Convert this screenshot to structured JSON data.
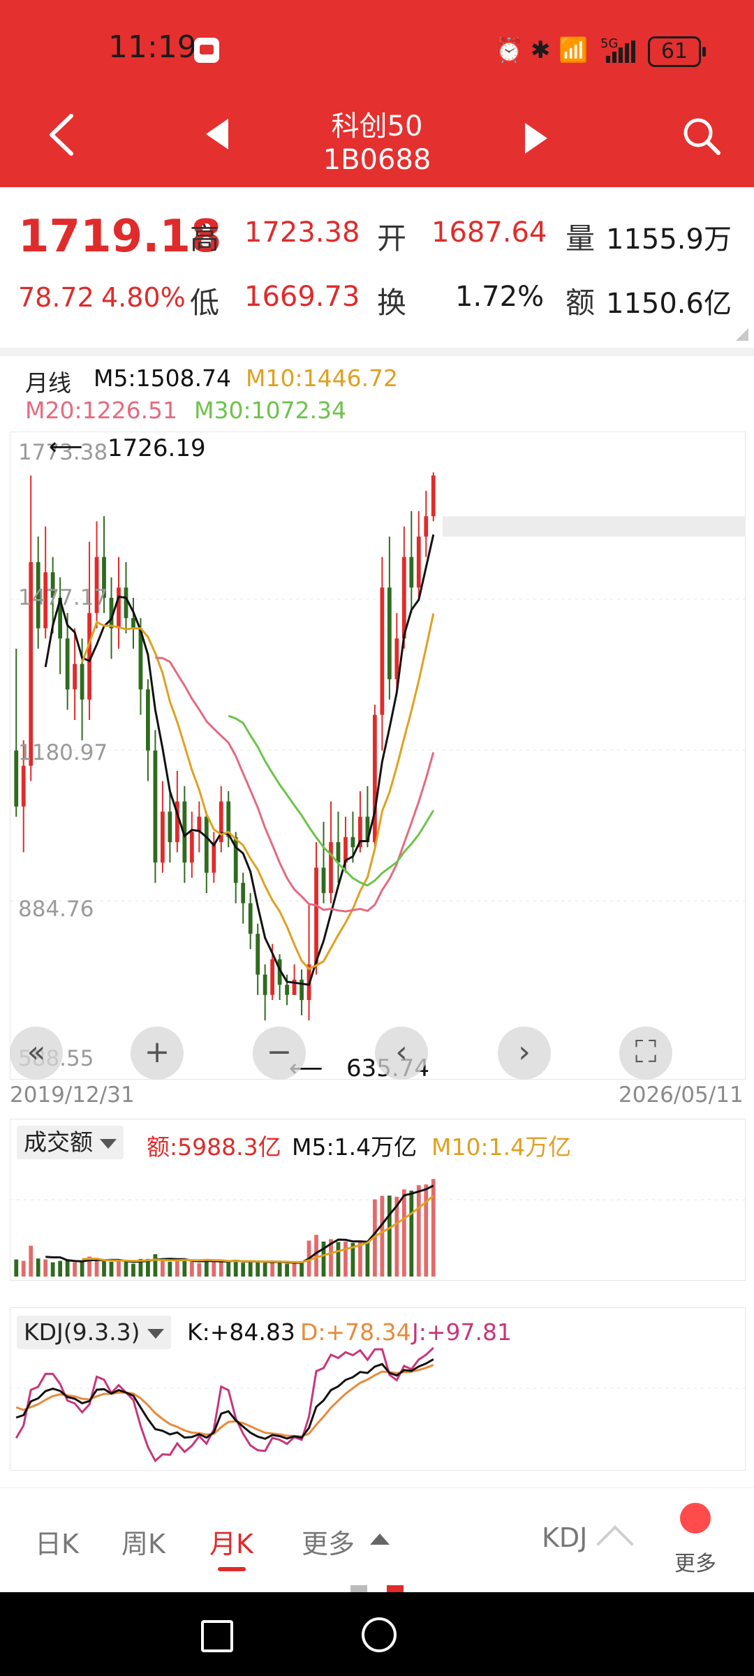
{
  "status_bar": {
    "time": "11:19",
    "battery": "61",
    "signal": "5G"
  },
  "header": {
    "name": "科创50",
    "code": "1B0688"
  },
  "quote": {
    "last": "1719.18",
    "change": "78.72",
    "change_pct": "4.80%",
    "high_label": "高",
    "high": "1723.38",
    "low_label": "低",
    "low": "1669.73",
    "open_label": "开",
    "open": "1687.64",
    "turnover_label": "换",
    "turnover": "1.72%",
    "volume_label": "量",
    "volume": "1155.9万",
    "amount_label": "额",
    "amount": "1150.6亿"
  },
  "ma_legend": {
    "period": "月线",
    "m5": "M5:1508.74",
    "m10": "M10:1446.72",
    "m20": "M20:1226.51",
    "m30": "M30:1072.34"
  },
  "price_axis": {
    "labels": [
      "1773.38",
      "1477.17",
      "1180.97",
      "884.76",
      "588.55"
    ],
    "max_marker": "1726.19",
    "min_marker": "635.74"
  },
  "date_range": {
    "start": "2019/12/31",
    "end": "2026/05/11"
  },
  "volume_panel": {
    "selector": "成交额",
    "amount": "额:5988.3亿",
    "m5": "M5:1.4万亿",
    "m10": "M10:1.4万亿"
  },
  "kdj_panel": {
    "selector": "KDJ(9.3.3)",
    "k": "K:+84.83",
    "d": "D:+78.34",
    "j": "J:+97.81"
  },
  "tabs": {
    "day": "日K",
    "week": "周K",
    "month": "月K",
    "more": "更多",
    "indicator": "KDJ",
    "more_btn": "更多"
  },
  "colors": {
    "header_red": "#e4302f",
    "up": "#e02b2b",
    "down": "#2f6b1e",
    "m5": "#111111",
    "m10": "#e0a020",
    "m20": "#e56a80",
    "m30": "#6cc34a",
    "k": "#111111",
    "d": "#e88a3a",
    "j": "#c8367a"
  },
  "chart_data": {
    "type": "candlestick",
    "period": "monthly",
    "ylim": [
      588.55,
      1773.38
    ],
    "x_range": [
      "2019/12/31",
      "2026/05/11"
    ],
    "candles": [
      [
        1180,
        1070,
        1380,
        1050
      ],
      [
        1070,
        1150,
        1200,
        980
      ],
      [
        1150,
        1550,
        1720,
        1120
      ],
      [
        1550,
        1420,
        1600,
        1380
      ],
      [
        1420,
        1530,
        1620,
        1400
      ],
      [
        1530,
        1480,
        1560,
        1410
      ],
      [
        1480,
        1400,
        1520,
        1330
      ],
      [
        1400,
        1300,
        1450,
        1260
      ],
      [
        1300,
        1350,
        1420,
        1240
      ],
      [
        1350,
        1280,
        1400,
        1200
      ],
      [
        1280,
        1450,
        1590,
        1240
      ],
      [
        1450,
        1560,
        1630,
        1420
      ],
      [
        1560,
        1480,
        1640,
        1450
      ],
      [
        1480,
        1420,
        1520,
        1360
      ],
      [
        1420,
        1500,
        1560,
        1380
      ],
      [
        1500,
        1440,
        1550,
        1410
      ],
      [
        1440,
        1420,
        1480,
        1380
      ],
      [
        1420,
        1300,
        1440,
        1250
      ],
      [
        1300,
        1180,
        1320,
        1120
      ],
      [
        1180,
        960,
        1220,
        920
      ],
      [
        960,
        1060,
        1120,
        940
      ],
      [
        1060,
        1000,
        1100,
        960
      ],
      [
        1000,
        1080,
        1140,
        980
      ],
      [
        1080,
        960,
        1110,
        920
      ],
      [
        960,
        1020,
        1060,
        930
      ],
      [
        1020,
        1050,
        1080,
        980
      ],
      [
        1050,
        940,
        1060,
        900
      ],
      [
        940,
        1000,
        1020,
        920
      ],
      [
        1000,
        1080,
        1110,
        980
      ],
      [
        1080,
        1010,
        1100,
        990
      ],
      [
        1010,
        920,
        1020,
        880
      ],
      [
        920,
        880,
        940,
        840
      ],
      [
        880,
        820,
        900,
        790
      ],
      [
        820,
        740,
        840,
        700
      ],
      [
        740,
        700,
        760,
        650
      ],
      [
        700,
        770,
        800,
        690
      ],
      [
        770,
        720,
        780,
        690
      ],
      [
        720,
        700,
        740,
        680
      ],
      [
        700,
        730,
        760,
        700
      ],
      [
        730,
        690,
        750,
        660
      ],
      [
        690,
        760,
        880,
        650
      ],
      [
        760,
        950,
        1000,
        740
      ],
      [
        950,
        900,
        1040,
        880
      ],
      [
        900,
        1000,
        1080,
        880
      ],
      [
        1000,
        960,
        1060,
        920
      ],
      [
        960,
        1010,
        1050,
        940
      ],
      [
        1010,
        990,
        1060,
        960
      ],
      [
        990,
        1050,
        1100,
        980
      ],
      [
        1050,
        1000,
        1110,
        990
      ],
      [
        1000,
        1250,
        1270,
        990
      ],
      [
        1250,
        1500,
        1560,
        1180
      ],
      [
        1500,
        1320,
        1600,
        1280
      ],
      [
        1320,
        1400,
        1450,
        1300
      ],
      [
        1400,
        1560,
        1620,
        1380
      ],
      [
        1560,
        1500,
        1650,
        1450
      ],
      [
        1500,
        1600,
        1650,
        1480
      ],
      [
        1600,
        1640,
        1690,
        1560
      ],
      [
        1640,
        1720,
        1726.19,
        1630
      ]
    ],
    "series": [
      {
        "name": "M5",
        "last": 1508.74
      },
      {
        "name": "M10",
        "last": 1446.72
      },
      {
        "name": "M20",
        "last": 1226.51
      },
      {
        "name": "M30",
        "last": 1072.34
      }
    ],
    "kdj": {
      "K": 84.83,
      "D": 78.34,
      "J": 97.81
    },
    "volume_amount": "5988.3亿"
  }
}
